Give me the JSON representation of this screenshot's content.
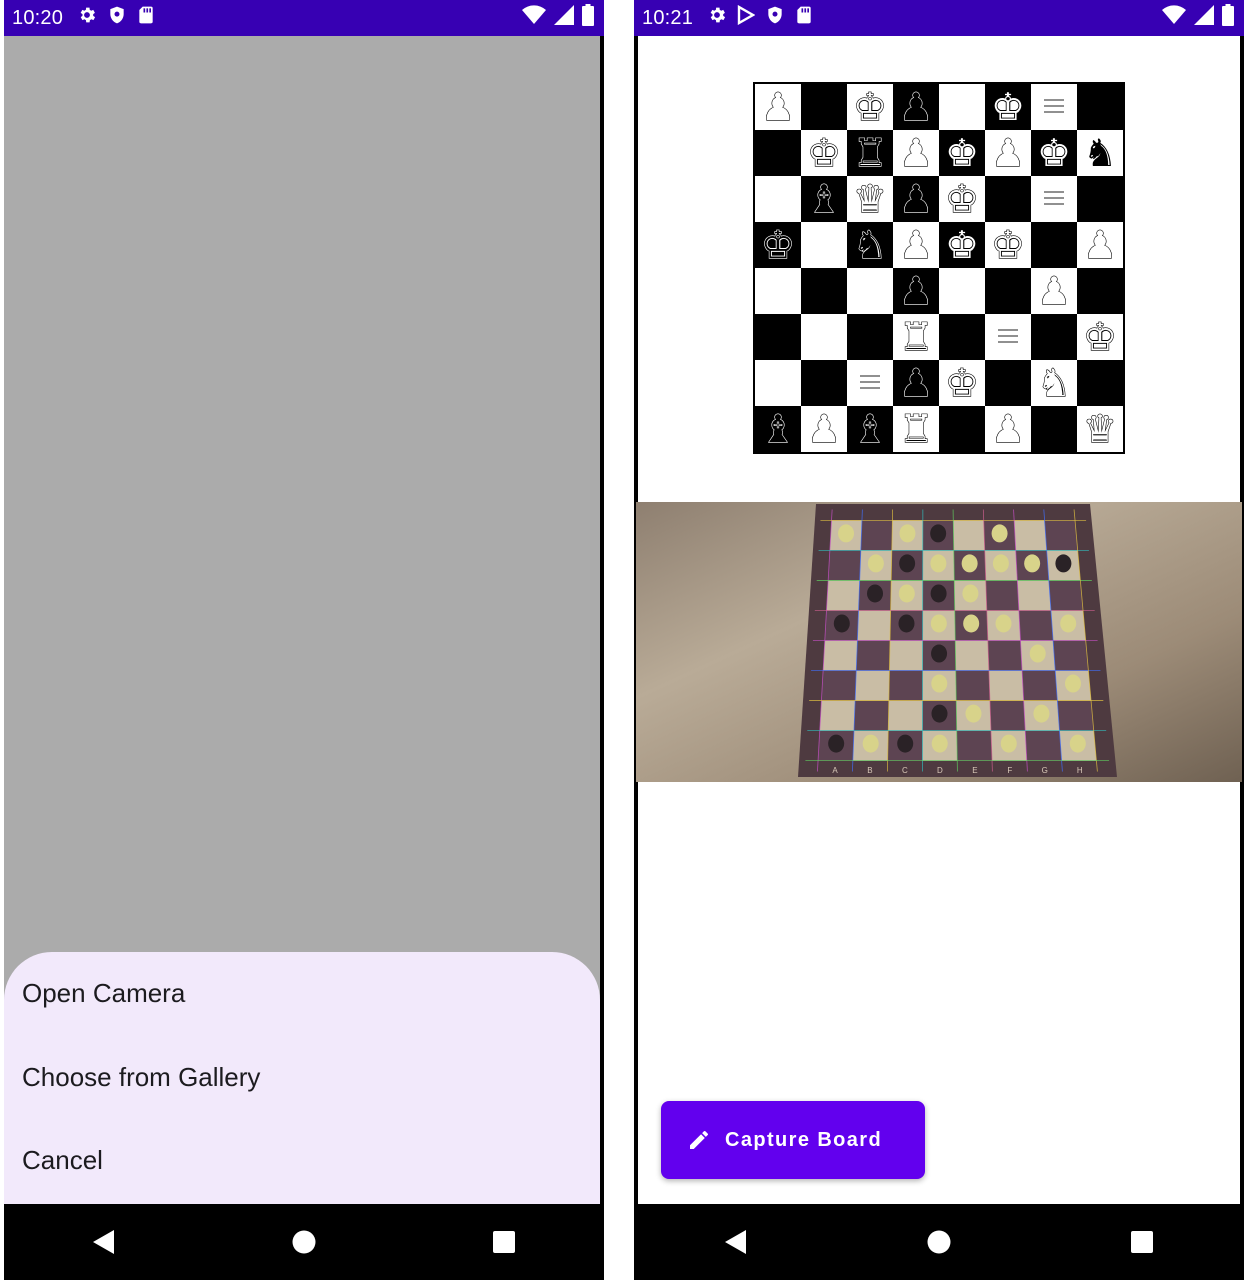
{
  "left_phone": {
    "status_bar": {
      "time": "10:20",
      "left_icons": [
        "gear-icon",
        "shield-icon",
        "sd-card-icon"
      ],
      "right_icons": [
        "wifi-icon",
        "signal-icon",
        "battery-icon"
      ]
    },
    "bottom_sheet": {
      "items": [
        {
          "label": "Open Camera"
        },
        {
          "label": "Choose from Gallery"
        },
        {
          "label": "Cancel"
        }
      ]
    },
    "nav_bar": [
      "back-icon",
      "home-icon",
      "recents-icon"
    ],
    "colors": {
      "status_bar": "#3700b3",
      "scrim": "#ababab",
      "sheet": "#f2e9fb"
    }
  },
  "right_phone": {
    "status_bar": {
      "time": "10:21",
      "left_icons": [
        "gear-icon",
        "play-store-icon",
        "shield-icon",
        "sd-card-icon"
      ],
      "right_icons": [
        "wifi-icon",
        "signal-icon",
        "battery-icon"
      ]
    },
    "board": {
      "rows": [
        [
          "wP",
          "",
          "wK",
          "bP",
          "",
          "wK",
          "~",
          ""
        ],
        [
          "",
          "wK",
          "bR",
          "wP",
          "wK",
          "wP",
          "wK",
          "bN"
        ],
        [
          "",
          "bB",
          "wQ",
          "bP",
          "wK",
          "",
          "~",
          ""
        ],
        [
          "bK",
          "",
          "bN",
          "wP",
          "wK",
          "wK",
          "",
          "wP"
        ],
        [
          "",
          "",
          "",
          "bP",
          "",
          "",
          "wP",
          ""
        ],
        [
          "",
          "",
          "",
          "wR",
          "",
          "~",
          "",
          "wK"
        ],
        [
          "",
          "",
          "~",
          "bP",
          "wK",
          "",
          "wN",
          ""
        ],
        [
          "bB",
          "wP",
          "bB",
          "wR",
          "",
          "wP",
          "",
          "wQ"
        ]
      ]
    },
    "photo": {
      "file_labels": [
        "A",
        "B",
        "C",
        "D",
        "E",
        "F",
        "G",
        "H"
      ]
    },
    "fab": {
      "label": "Capture Board",
      "icon": "pencil-icon"
    },
    "nav_bar": [
      "back-icon",
      "home-icon",
      "recents-icon"
    ],
    "colors": {
      "accent": "#6200ee",
      "status_bar": "#3700b3"
    }
  }
}
